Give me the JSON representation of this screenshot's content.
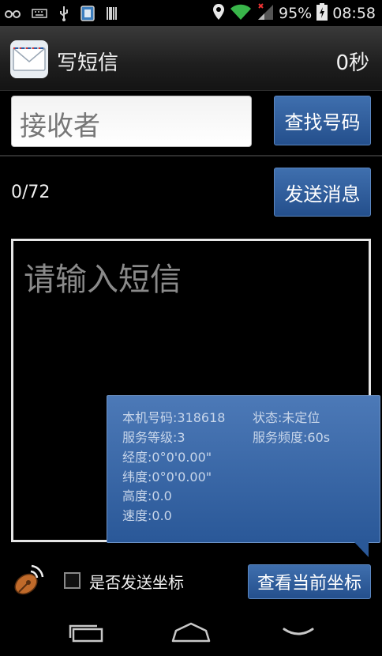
{
  "status_bar": {
    "left_icons": [
      "glasses-icon",
      "keyboard-icon",
      "usb-icon",
      "sim-card-icon",
      "barcode-icon"
    ],
    "right_icons": [
      "location-pin-icon",
      "wifi-icon",
      "signal-icon",
      "battery-charging-icon"
    ],
    "battery_percent": "95%",
    "time": "08:58"
  },
  "action_bar": {
    "app_icon": "envelope-icon",
    "title": "写短信",
    "timer": "0秒"
  },
  "recipient": {
    "placeholder": "接收者",
    "find_button": "查找号码"
  },
  "compose": {
    "counter": "0/72",
    "send_button": "发送消息",
    "message_placeholder": "请输入短信"
  },
  "info_popup": {
    "rows": [
      {
        "left": "本机号码:318618",
        "right": "状态:未定位"
      },
      {
        "left": "服务等级:3",
        "right": "服务频度:60s"
      },
      {
        "left": "经度:0°0'0.00\"",
        "right": ""
      },
      {
        "left": "纬度:0°0'0.00\"",
        "right": ""
      },
      {
        "left": "高度:0.0",
        "right": ""
      },
      {
        "left": "速度:0.0",
        "right": ""
      }
    ]
  },
  "bottom": {
    "satellite_icon": "satellite-dish-icon",
    "checkbox_label": "是否发送坐标",
    "checkbox_checked": false,
    "coords_button": "查看当前坐标"
  },
  "nav_bar": {
    "icons": [
      "recent-apps-icon",
      "home-icon",
      "back-icon"
    ]
  },
  "colors": {
    "button_blue": "#2f5c99",
    "popup_blue": "#3a68a8",
    "background": "#000000"
  }
}
